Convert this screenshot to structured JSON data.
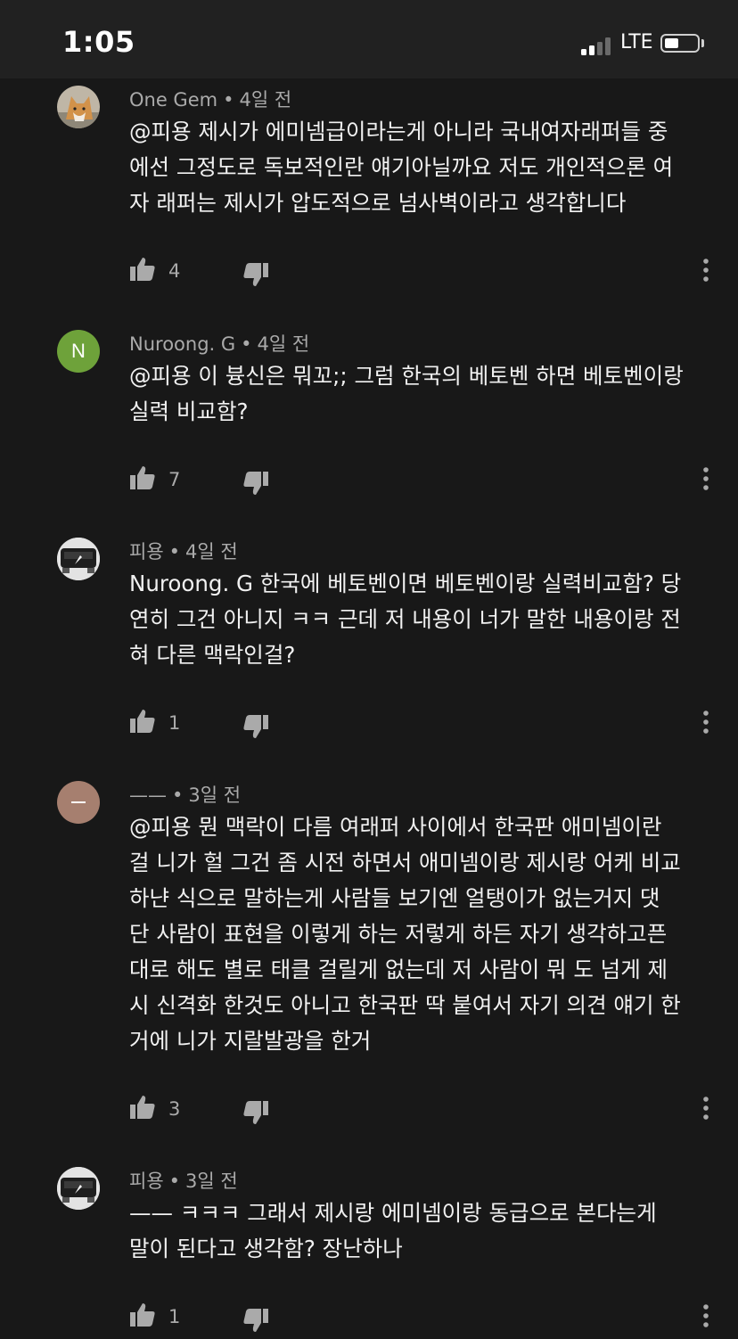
{
  "status_bar": {
    "time": "1:05",
    "network": "LTE",
    "signal_bars": 2,
    "battery_level": 0.35
  },
  "colors": {
    "background": "#181818",
    "text": "#f1f1f1",
    "secondary_text": "#aaaaaa",
    "avatar_n": "#6ea23a",
    "avatar_dash": "#a67f6f"
  },
  "comments": [
    {
      "author": "One Gem",
      "time": "4일 전",
      "avatar": "fox-photo",
      "lines": [
        "@피용 제시가 에미넴급이라는게 아니라 국내여자래퍼들 중",
        "에선 그정도로 독보적인란 얘기아닐까요 저도 개인적으론 여",
        "자 래퍼는 제시가 압도적으로 넘사벽이라고 생각합니다"
      ],
      "likes": "4"
    },
    {
      "author": "Nuroong. G",
      "time": "4일 전",
      "avatar": "letter",
      "avatar_letter": "N",
      "lines": [
        "@피용 이 븅신은 뭐꼬;; 그럼 한국의 베토벤 하면 베토벤이랑",
        "실력 비교함?"
      ],
      "likes": "7"
    },
    {
      "author": "피용",
      "time": "4일 전",
      "avatar": "car-photo",
      "lines": [
        "Nuroong. G 한국에 베토벤이면 베토벤이랑 실력비교함? 당",
        "연히 그건 아니지 ㅋㅋ 근데 저 내용이 너가 말한 내용이랑 전",
        "혀 다른 맥락인걸?"
      ],
      "likes": "1"
    },
    {
      "author": "——",
      "time": "3일 전",
      "avatar": "dash",
      "lines": [
        "@피용 뭔 맥락이 다름 여래퍼 사이에서 한국판 애미넴이란",
        "걸 니가 헐 그건 좀 시전 하면서 애미넴이랑 제시랑 어케 비교",
        "하냔 식으로 말하는게 사람들 보기엔 얼탱이가 없는거지 댓",
        "단 사람이 표현을 이렇게 하는 저렇게 하든 자기 생각하고픈",
        "대로 해도 별로 태클 걸릴게 없는데 저 사람이 뭐 도 넘게 제",
        "시 신격화 한것도 아니고 한국판 딱 붙여서 자기 의견 얘기 한",
        "거에 니가 지랄발광을 한거"
      ],
      "likes": "3"
    },
    {
      "author": "피용",
      "time": "3일 전",
      "avatar": "car-photo",
      "lines": [
        "—— ㅋㅋㅋ 그래서 제시랑 에미넴이랑 동급으로 본다는게",
        "말이 된다고 생각함? 장난하나"
      ],
      "likes": "1"
    }
  ]
}
